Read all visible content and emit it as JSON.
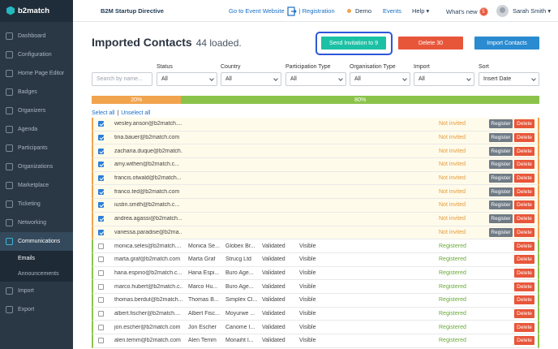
{
  "brand": {
    "name": "b2match"
  },
  "header": {
    "event_name": "B2M Startup Directive",
    "goto_event": "Go to Event Website",
    "registration": "Registration",
    "separator": "|",
    "demo": "Demo",
    "events": "Events",
    "help": "Help ▾",
    "whats_new": "What's new",
    "whats_new_count": "5",
    "user": "Sarah Smith ▾"
  },
  "sidebar": {
    "items": [
      {
        "label": "Dashboard",
        "icon": "dashboard-icon"
      },
      {
        "label": "Configuration",
        "icon": "gear-icon"
      },
      {
        "label": "Home Page Editor",
        "icon": "edit-icon"
      },
      {
        "label": "Badges",
        "icon": "badge-icon"
      },
      {
        "label": "Organizers",
        "icon": "organizers-icon"
      },
      {
        "label": "Agenda",
        "icon": "calendar-icon"
      },
      {
        "label": "Participants",
        "icon": "participants-icon"
      },
      {
        "label": "Organizations",
        "icon": "building-icon"
      },
      {
        "label": "Marketplace",
        "icon": "marketplace-icon"
      },
      {
        "label": "Ticketing",
        "icon": "ticket-icon"
      },
      {
        "label": "Networking",
        "icon": "network-icon"
      },
      {
        "label": "Communications",
        "icon": "chat-icon"
      }
    ],
    "sub_items": [
      {
        "label": "Emails"
      },
      {
        "label": "Announcements"
      }
    ],
    "bottom_items": [
      {
        "label": "Import",
        "icon": "import-icon"
      },
      {
        "label": "Export",
        "icon": "export-icon"
      }
    ]
  },
  "page": {
    "title": "Imported Contacts",
    "count": "44 loaded.",
    "send_btn": "Send Invitation to 9",
    "delete_btn": "Delete 30",
    "import_btn": "Import Contacts"
  },
  "filters": {
    "search_placeholder": "Search by name...",
    "status": {
      "label": "Status",
      "value": "All"
    },
    "country": {
      "label": "Country",
      "value": "All"
    },
    "participation_type": {
      "label": "Participation Type",
      "value": "All"
    },
    "organisation_type": {
      "label": "Organisation Type",
      "value": "All"
    },
    "import": {
      "label": "Import",
      "value": "All"
    },
    "sort": {
      "label": "Sort",
      "value": "Insert Date"
    }
  },
  "progress": {
    "not_invited_pct": 20,
    "not_invited_label": "20%",
    "registered_pct": 80,
    "registered_label": "80%",
    "not_invited_color": "#f2a34d",
    "registered_color": "#8bc34a"
  },
  "selection": {
    "select_all": "Select all",
    "unselect_all": "Unselect all",
    "separator": "|"
  },
  "buttons": {
    "register": "Register",
    "delete": "Delete"
  },
  "rows": [
    {
      "email": "wesley.anson@b2match....",
      "name": "",
      "org": "",
      "validated": "",
      "visible": "",
      "status": "Not invited",
      "checked": true,
      "type": "notinv"
    },
    {
      "email": "tina.bauer@b2match.com",
      "name": "",
      "org": "",
      "validated": "",
      "visible": "",
      "status": "Not invited",
      "checked": true,
      "type": "notinv"
    },
    {
      "email": "zacharia.duque@b2match...",
      "name": "",
      "org": "",
      "validated": "",
      "visible": "",
      "status": "Not invited",
      "checked": true,
      "type": "notinv"
    },
    {
      "email": "amy.withen@b2match.c...",
      "name": "",
      "org": "",
      "validated": "",
      "visible": "",
      "status": "Not invited",
      "checked": true,
      "type": "notinv"
    },
    {
      "email": "francis.otwald@b2match...",
      "name": "",
      "org": "",
      "validated": "",
      "visible": "",
      "status": "Not invited",
      "checked": true,
      "type": "notinv"
    },
    {
      "email": "franco.ted@b2match.com",
      "name": "",
      "org": "",
      "validated": "",
      "visible": "",
      "status": "Not invited",
      "checked": true,
      "type": "notinv"
    },
    {
      "email": "iustin.smith@b2match.c...",
      "name": "",
      "org": "",
      "validated": "",
      "visible": "",
      "status": "Not invited",
      "checked": true,
      "type": "notinv"
    },
    {
      "email": "andrea.agassi@b2match...",
      "name": "",
      "org": "",
      "validated": "",
      "visible": "",
      "status": "Not invited",
      "checked": true,
      "type": "notinv"
    },
    {
      "email": "vanessa.paradise@b2ma...",
      "name": "",
      "org": "",
      "validated": "",
      "visible": "",
      "status": "Not invited",
      "checked": true,
      "type": "notinv"
    },
    {
      "email": "monica.seles@b2match....",
      "name": "Monica Se...",
      "org": "Globex Br...",
      "validated": "Validated",
      "visible": "Visible",
      "status": "Registered",
      "checked": false,
      "type": "reg"
    },
    {
      "email": "marta.graf@b2match.com",
      "name": "Marta Graf",
      "org": "Strucg Ltd",
      "validated": "Validated",
      "visible": "Visible",
      "status": "Registered",
      "checked": false,
      "type": "reg"
    },
    {
      "email": "hana.espino@b2match.c...",
      "name": "Hana Espi...",
      "org": "Buro Age...",
      "validated": "Validated",
      "visible": "Visible",
      "status": "Registered",
      "checked": false,
      "type": "reg"
    },
    {
      "email": "marco.hubert@b2match.c...",
      "name": "Marco Hu...",
      "org": "Buro Age...",
      "validated": "Validated",
      "visible": "Visible",
      "status": "Registered",
      "checked": false,
      "type": "reg"
    },
    {
      "email": "thomas.berdut@b2match...",
      "name": "Thomas B...",
      "org": "Simplex Cl...",
      "validated": "Validated",
      "visible": "Visible",
      "status": "Registered",
      "checked": false,
      "type": "reg"
    },
    {
      "email": "albert.fischer@b2match....",
      "name": "Albert Fisc...",
      "org": "Moyurwe ...",
      "validated": "Validated",
      "visible": "Visible",
      "status": "Registered",
      "checked": false,
      "type": "reg"
    },
    {
      "email": "jon.escher@b2match.com",
      "name": "Jon Escher",
      "org": "Canome I...",
      "validated": "Validated",
      "visible": "Visible",
      "status": "Registered",
      "checked": false,
      "type": "reg"
    },
    {
      "email": "alen.temm@b2match.com",
      "name": "Alen Temm",
      "org": "Monaiht I...",
      "validated": "Validated",
      "visible": "Visible",
      "status": "Registered",
      "checked": false,
      "type": "reg"
    }
  ]
}
